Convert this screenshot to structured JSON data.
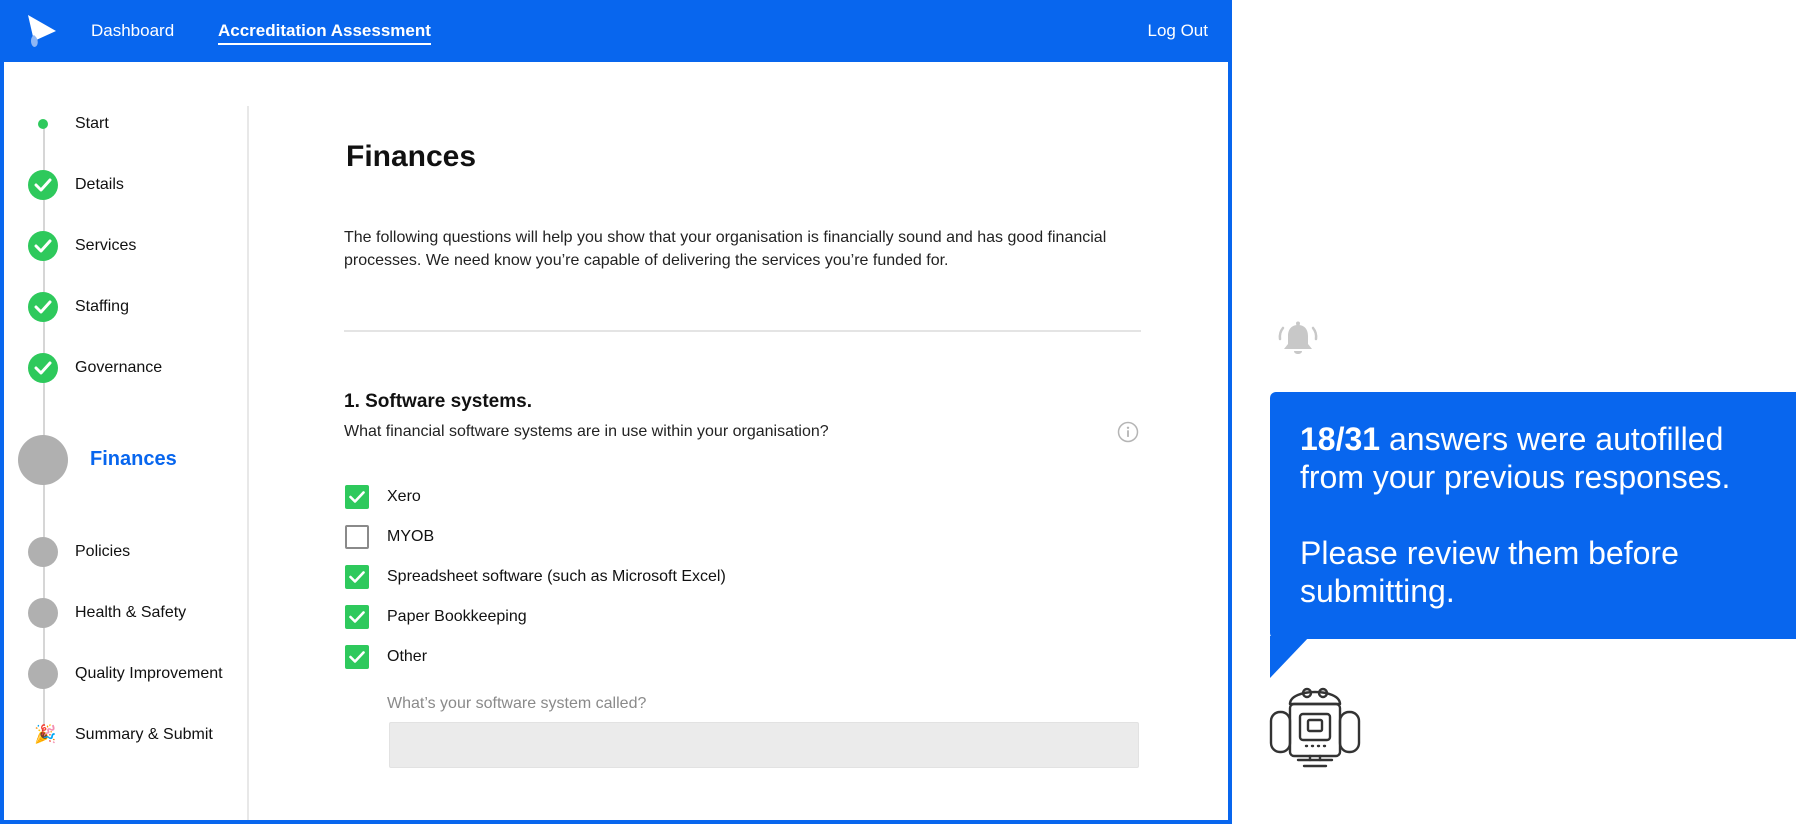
{
  "nav": {
    "dashboard": "Dashboard",
    "assessment": "Accreditation Assessment",
    "logout": "Log Out"
  },
  "steps": [
    {
      "label": "Start",
      "status": "start"
    },
    {
      "label": "Details",
      "status": "complete"
    },
    {
      "label": "Services",
      "status": "complete"
    },
    {
      "label": "Staffing",
      "status": "complete"
    },
    {
      "label": "Governance",
      "status": "complete"
    },
    {
      "label": "Finances",
      "status": "current"
    },
    {
      "label": "Policies",
      "status": "pending"
    },
    {
      "label": "Health & Safety",
      "status": "pending"
    },
    {
      "label": "Quality Improvement",
      "status": "pending"
    },
    {
      "label": "Summary & Submit",
      "status": "final",
      "icon": "🎉"
    }
  ],
  "page": {
    "title": "Finances",
    "intro": "The following questions will help you show that your organisation is financially sound and has good financial processes. We need know you’re capable of delivering the services you’re funded for."
  },
  "question": {
    "title": "1. Software systems.",
    "text": "What financial software systems are in use within your organisation?",
    "options": [
      {
        "label": "Xero",
        "checked": true
      },
      {
        "label": "MYOB",
        "checked": false
      },
      {
        "label": "Spreadsheet software (such as Microsoft Excel)",
        "checked": true
      },
      {
        "label": "Paper Bookkeeping",
        "checked": true
      },
      {
        "label": "Other",
        "checked": true
      }
    ],
    "followup_label": "What’s your software system called?",
    "followup_value": ""
  },
  "notice": {
    "count": "18/31",
    "message_rest": " answers were autofilled from your previous responses.",
    "message_2": "Please review them before submitting."
  },
  "colors": {
    "brand_blue": "#0866ee",
    "success_green": "#2ec95c",
    "pending_grey": "#b0b0b0"
  }
}
